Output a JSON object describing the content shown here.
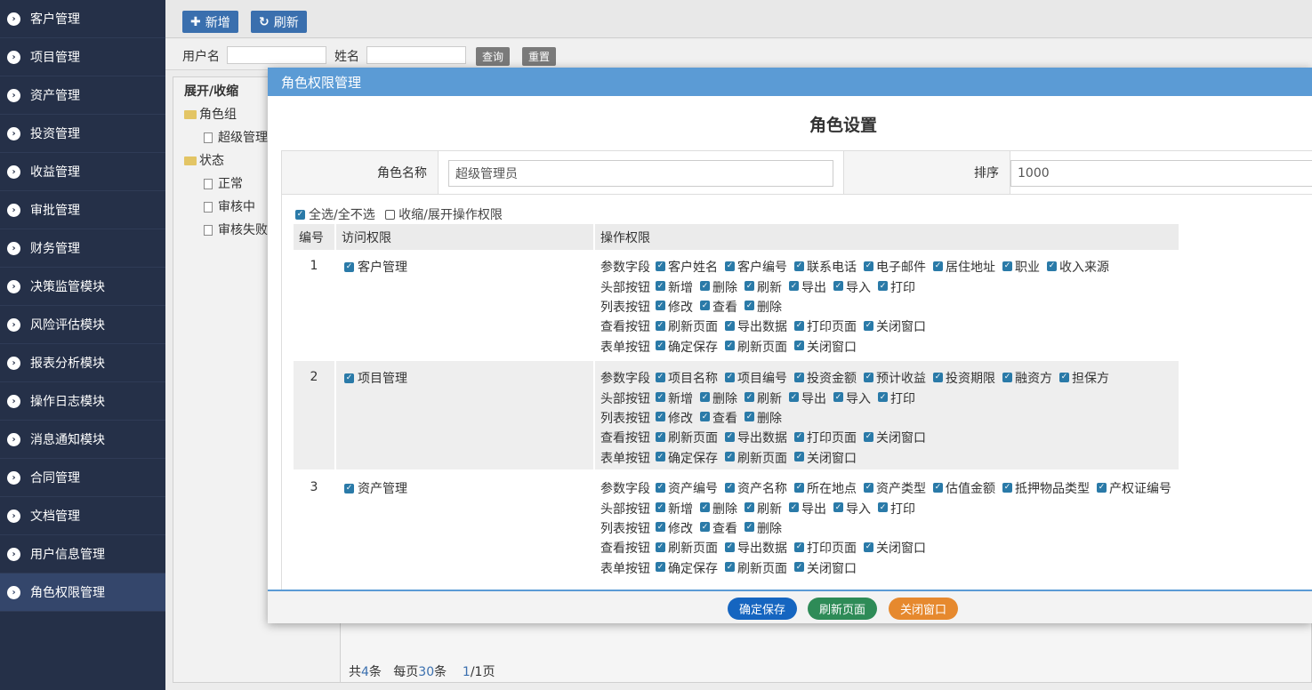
{
  "sidebar": {
    "items": [
      {
        "label": "客户管理"
      },
      {
        "label": "项目管理"
      },
      {
        "label": "资产管理"
      },
      {
        "label": "投资管理"
      },
      {
        "label": "收益管理"
      },
      {
        "label": "审批管理"
      },
      {
        "label": "财务管理"
      },
      {
        "label": "决策监管模块"
      },
      {
        "label": "风险评估模块"
      },
      {
        "label": "报表分析模块"
      },
      {
        "label": "操作日志模块"
      },
      {
        "label": "消息通知模块"
      },
      {
        "label": "合同管理"
      },
      {
        "label": "文档管理"
      },
      {
        "label": "用户信息管理"
      },
      {
        "label": "角色权限管理"
      }
    ],
    "active_index": 15,
    "bg_color": "#253048",
    "active_color": "#34466b"
  },
  "toolbar": {
    "add_label": "新增",
    "refresh_label": "刷新",
    "accent": "#3a6fae"
  },
  "search": {
    "username_label": "用户名",
    "name_label": "姓名",
    "query_label": "查询",
    "reset_label": "重置"
  },
  "tree": {
    "root": "展开/收缩",
    "group": "角色组",
    "group_child": "超级管理",
    "status": "状态",
    "status_children": [
      "正常",
      "审核中",
      "审核失败"
    ]
  },
  "pager": {
    "prefix": "共",
    "total": "4",
    "total_unit": "条",
    "per_page_prefix": "每页",
    "per_page": "30",
    "per_page_unit": "条",
    "current": "1",
    "pages": "/1页"
  },
  "modal": {
    "header": "角色权限管理",
    "title": "角色设置",
    "header_color": "#5b9bd5",
    "form": {
      "role_name_label": "角色名称",
      "role_name_value": "超级管理员",
      "sort_label": "排序",
      "sort_value": "1000"
    },
    "select_all": "全选/全不选",
    "toggle_ops": "收缩/展开操作权限",
    "columns": {
      "num": "编号",
      "access": "访问权限",
      "ops": "操作权限"
    },
    "rows": [
      {
        "num": "1",
        "access": "客户管理",
        "groups": [
          {
            "label": "参数字段",
            "items": [
              "客户姓名",
              "客户编号",
              "联系电话",
              "电子邮件",
              "居住地址",
              "职业",
              "收入来源"
            ]
          },
          {
            "label": "头部按钮",
            "items": [
              "新增",
              "删除",
              "刷新",
              "导出",
              "导入",
              "打印"
            ]
          },
          {
            "label": "列表按钮",
            "items": [
              "修改",
              "查看",
              "删除"
            ]
          },
          {
            "label": "查看按钮",
            "items": [
              "刷新页面",
              "导出数据",
              "打印页面",
              "关闭窗口"
            ]
          },
          {
            "label": "表单按钮",
            "items": [
              "确定保存",
              "刷新页面",
              "关闭窗口"
            ]
          }
        ]
      },
      {
        "num": "2",
        "access": "项目管理",
        "groups": [
          {
            "label": "参数字段",
            "items": [
              "项目名称",
              "项目编号",
              "投资金额",
              "预计收益",
              "投资期限",
              "融资方",
              "担保方"
            ]
          },
          {
            "label": "头部按钮",
            "items": [
              "新增",
              "删除",
              "刷新",
              "导出",
              "导入",
              "打印"
            ]
          },
          {
            "label": "列表按钮",
            "items": [
              "修改",
              "查看",
              "删除"
            ]
          },
          {
            "label": "查看按钮",
            "items": [
              "刷新页面",
              "导出数据",
              "打印页面",
              "关闭窗口"
            ]
          },
          {
            "label": "表单按钮",
            "items": [
              "确定保存",
              "刷新页面",
              "关闭窗口"
            ]
          }
        ]
      },
      {
        "num": "3",
        "access": "资产管理",
        "groups": [
          {
            "label": "参数字段",
            "items": [
              "资产编号",
              "资产名称",
              "所在地点",
              "资产类型",
              "估值金额",
              "抵押物品类型",
              "产权证编号"
            ]
          },
          {
            "label": "头部按钮",
            "items": [
              "新增",
              "删除",
              "刷新",
              "导出",
              "导入",
              "打印"
            ]
          },
          {
            "label": "列表按钮",
            "items": [
              "修改",
              "查看",
              "删除"
            ]
          },
          {
            "label": "查看按钮",
            "items": [
              "刷新页面",
              "导出数据",
              "打印页面",
              "关闭窗口"
            ]
          },
          {
            "label": "表单按钮",
            "items": [
              "确定保存",
              "刷新页面",
              "关闭窗口"
            ]
          }
        ]
      }
    ],
    "footer": {
      "save": "确定保存",
      "refresh": "刷新页面",
      "close": "关闭窗口",
      "save_color": "#1565c0",
      "refresh_color": "#2e8b57",
      "close_color": "#e6892e"
    }
  }
}
